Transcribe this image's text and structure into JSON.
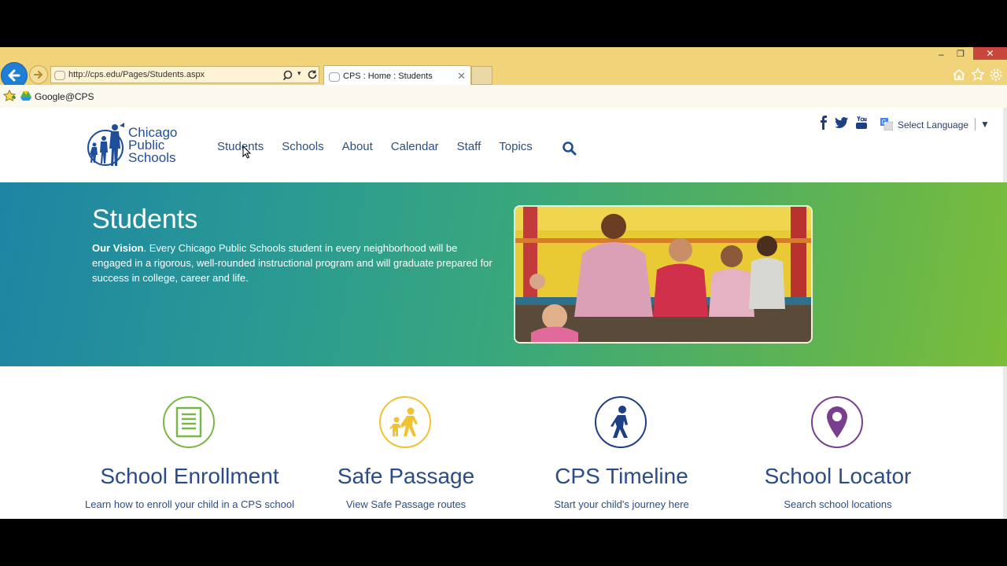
{
  "browser": {
    "address_url": "http://cps.edu/Pages/Students.aspx",
    "tab_title": "CPS : Home : Students",
    "favorites": [
      {
        "label": "Google@CPS",
        "icon": "google-drive-icon"
      }
    ]
  },
  "site": {
    "logo_lines": [
      "Chicago",
      "Public",
      "Schools"
    ],
    "nav": [
      "Students",
      "Schools",
      "About",
      "Calendar",
      "Staff",
      "Topics"
    ],
    "social_icons": [
      "facebook-icon",
      "twitter-icon",
      "youtube-icon"
    ],
    "language_label": "Select Language",
    "language_caret": "▼"
  },
  "hero": {
    "title": "Students",
    "vision_label": "Our Vision",
    "vision_text": ". Every Chicago Public Schools student in every neighborhood will be engaged in a rigorous, well-rounded instructional program and will graduate prepared for success in college, career and life."
  },
  "features": [
    {
      "title": "School Enrollment",
      "desc": "Learn how to enroll your child in a CPS school",
      "icon": "document-icon",
      "color": "#7ab648"
    },
    {
      "title": "Safe Passage",
      "desc": "View Safe Passage routes",
      "icon": "walking-family-icon",
      "color": "#f1c232"
    },
    {
      "title": "CPS Timeline",
      "desc": "Start your child's journey here",
      "icon": "walking-child-icon",
      "color": "#1f3f85"
    },
    {
      "title": "School Locator",
      "desc": "Search school locations",
      "icon": "map-pin-icon",
      "color": "#7a3e8e"
    }
  ],
  "colors": {
    "nav_text": "#2d4f7f",
    "brand_blue": "#1f4f9a",
    "browser_chrome": "#f1d37a"
  }
}
